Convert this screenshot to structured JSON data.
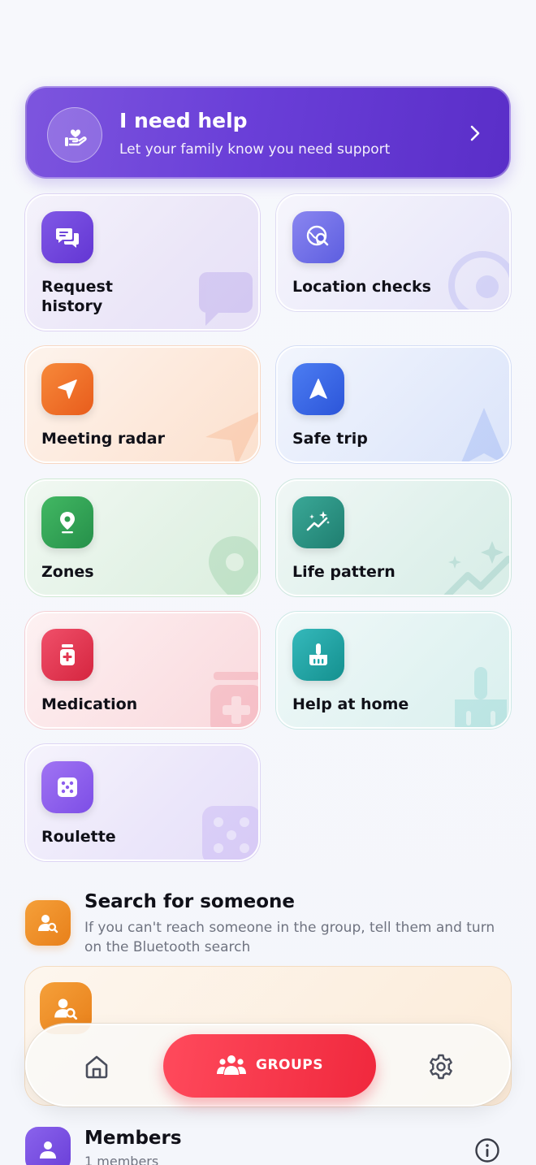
{
  "help_banner": {
    "title": "I need help",
    "subtitle": "Let your family know you need support"
  },
  "features": [
    {
      "label": "Request history",
      "icon": "chat-bubbles-icon",
      "color": "#6d45d9"
    },
    {
      "label": "Location checks",
      "icon": "globe-search-icon",
      "color": "#6b6ae6"
    },
    {
      "label": "Meeting radar",
      "icon": "navigation-arrow-icon",
      "color": "#f0702a"
    },
    {
      "label": "Safe trip",
      "icon": "compass-arrow-icon",
      "color": "#3566e8"
    },
    {
      "label": "Zones",
      "icon": "map-pin-icon",
      "color": "#2f9e4f"
    },
    {
      "label": "Life pattern",
      "icon": "sparkle-graph-icon",
      "color": "#2a8f80"
    },
    {
      "label": "Medication",
      "icon": "pill-bottle-icon",
      "color": "#e23752"
    },
    {
      "label": "Help at home",
      "icon": "broom-icon",
      "color": "#1aa5a8"
    },
    {
      "label": "Roulette",
      "icon": "dice-icon",
      "color": "#8c5ded"
    }
  ],
  "search_section": {
    "title": "Search for someone",
    "description": "If you can't reach someone in the group, tell them and turn on the Bluetooth search"
  },
  "bottom_nav": {
    "home_icon": "home-icon",
    "groups_label": "GROUPS",
    "settings_icon": "gear-icon",
    "accent": "#f0283d"
  },
  "members": {
    "title": "Members",
    "count": "1 members"
  }
}
